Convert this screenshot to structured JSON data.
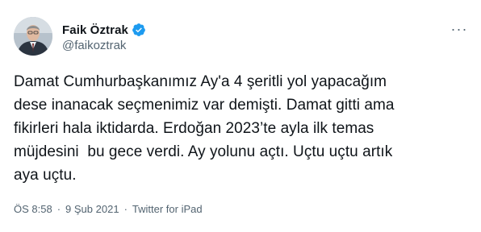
{
  "author": {
    "display_name": "Faik Öztrak",
    "handle": "@faikoztrak",
    "verified": true,
    "verified_icon": "verified-badge-icon"
  },
  "tweet": {
    "text": "Damat Cumhurbaşkanımız Ay'a 4 şeritli yol yapacağım\ndese inanacak seçmenimiz var demişti. Damat gitti ama\nfikirleri hala iktidarda. Erdoğan 2023’te ayla ilk temas\nmüjdesini  bu gece verdi. Ay yolunu açtı. Uçtu uçtu artık\naya uçtu."
  },
  "meta": {
    "time": "ÖS 8:58",
    "separator1": "·",
    "date": "9 Şub 2021",
    "separator2": "·",
    "source": "Twitter for iPad"
  },
  "menu": {
    "more_label": "···",
    "more_icon": "more-options-icon"
  },
  "colors": {
    "text_primary": "#0f1419",
    "text_secondary": "#536471",
    "verified_blue": "#1d9bf0"
  }
}
